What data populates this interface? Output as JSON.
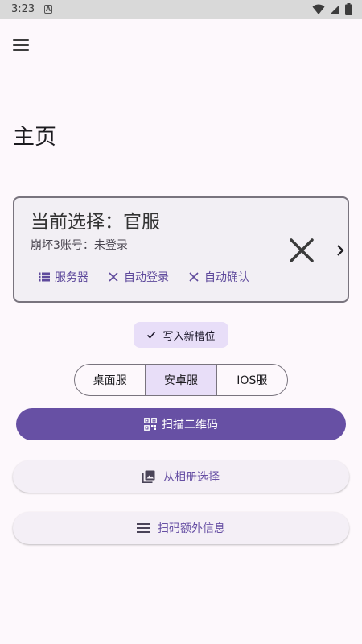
{
  "status_bar": {
    "time": "3:23",
    "notification_letter": "A"
  },
  "page": {
    "title": "主页"
  },
  "current_card": {
    "title": "当前选择：官服",
    "subtitle": "崩坏3账号：未登录",
    "actions": [
      {
        "label": "服务器",
        "icon": "list-icon"
      },
      {
        "label": "自动登录",
        "icon": "close-icon"
      },
      {
        "label": "自动确认",
        "icon": "close-icon"
      }
    ]
  },
  "chip": {
    "label": "写入新槽位",
    "checked": true
  },
  "segments": [
    {
      "label": "桌面服",
      "selected": false
    },
    {
      "label": "安卓服",
      "selected": true
    },
    {
      "label": "IOS服",
      "selected": false
    }
  ],
  "buttons": {
    "scan_qr": "扫描二维码",
    "from_album": "从相册选择",
    "extra_info": "扫码额外信息"
  },
  "colors": {
    "primary": "#6750a4",
    "secondary_container": "#e8def8",
    "background": "#fdf8fc"
  }
}
